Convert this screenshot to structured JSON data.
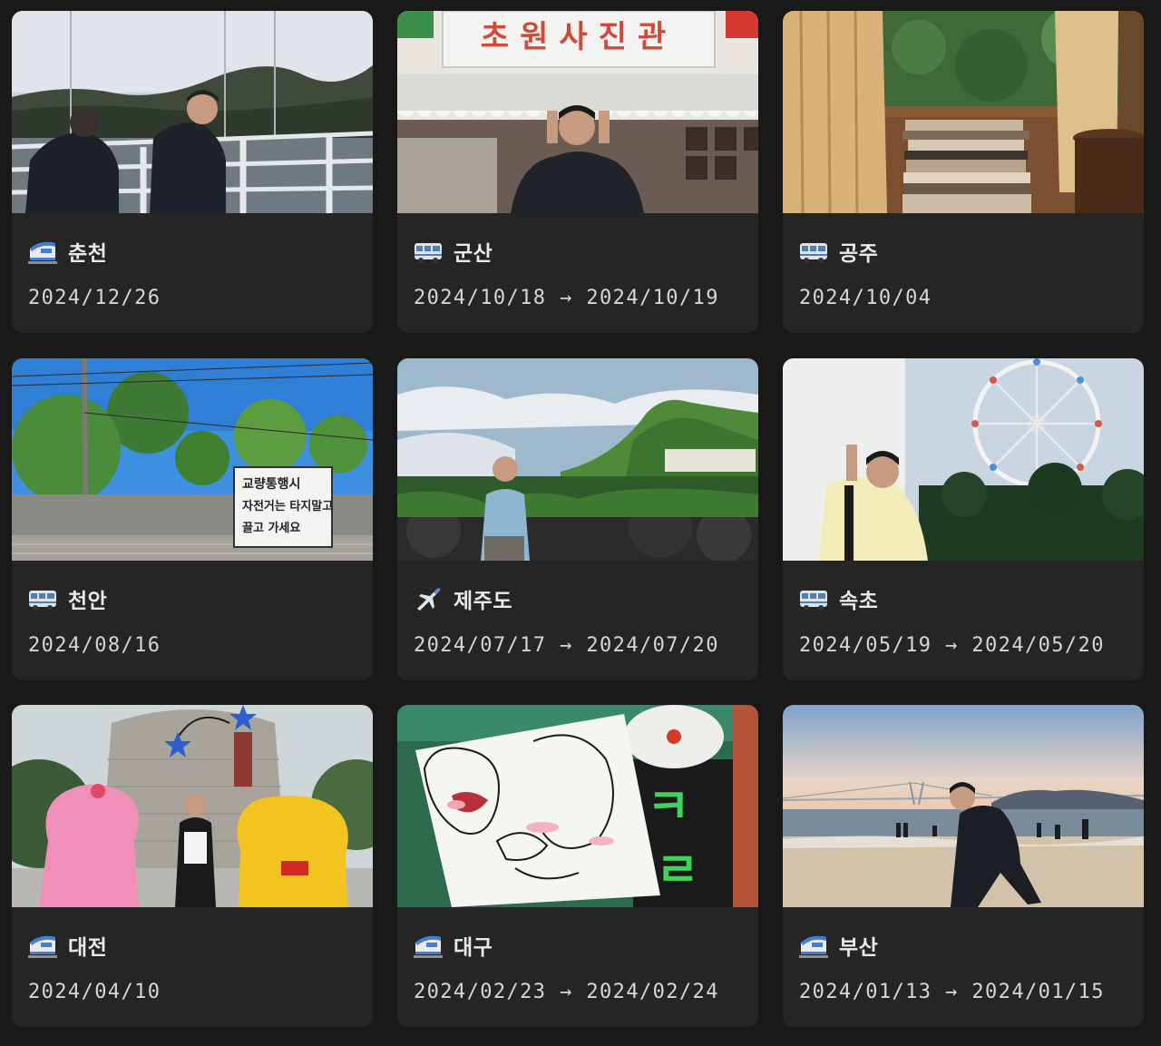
{
  "cards": [
    {
      "icon": "bullet-train-icon",
      "title": "춘천",
      "date": "2024/12/26"
    },
    {
      "icon": "bus-icon",
      "title": "군산",
      "date": "2024/10/18 → 2024/10/19",
      "sign": "초원사진관"
    },
    {
      "icon": "bus-icon",
      "title": "공주",
      "date": "2024/10/04"
    },
    {
      "icon": "bus-icon",
      "title": "천안",
      "date": "2024/08/16",
      "sign_lines": [
        "교량통행시",
        "자전거는 타지말고",
        "끌고 가세요"
      ]
    },
    {
      "icon": "airplane-icon",
      "title": "제주도",
      "date": "2024/07/17 → 2024/07/20"
    },
    {
      "icon": "bus-icon",
      "title": "속초",
      "date": "2024/05/19 → 2024/05/20"
    },
    {
      "icon": "bullet-train-icon",
      "title": "대전",
      "date": "2024/04/10"
    },
    {
      "icon": "bullet-train-icon",
      "title": "대구",
      "date": "2024/02/23 → 2024/02/24"
    },
    {
      "icon": "bullet-train-icon",
      "title": "부산",
      "date": "2024/01/13 → 2024/01/15"
    }
  ]
}
